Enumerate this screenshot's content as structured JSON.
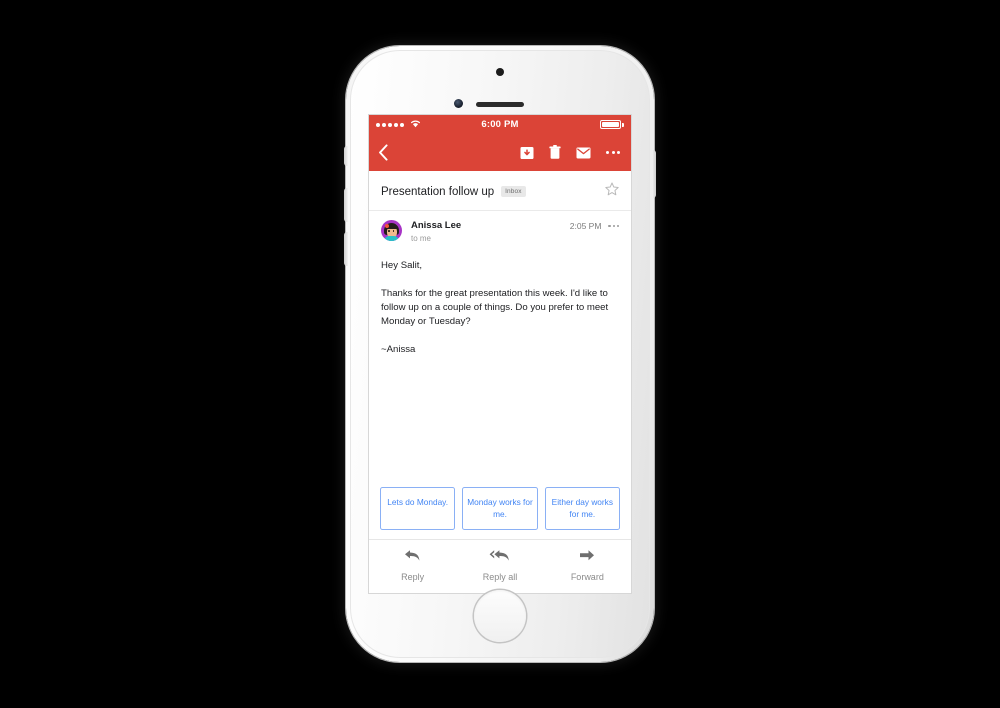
{
  "device": {
    "name": "iphone-white",
    "hardware": {
      "earpiece": "speaker-grille",
      "front_camera": "front-camera",
      "proximity_sensor": "proximity-sensor",
      "home_button": "home-button"
    }
  },
  "status_bar": {
    "signal_dots": 5,
    "wifi_icon": "wifi-icon",
    "time": "6:00 PM",
    "battery_icon": "battery-full-icon",
    "background_color": "#db4437"
  },
  "app_bar": {
    "back_icon": "back-chevron-icon",
    "actions": [
      {
        "icon": "archive-icon",
        "label": "Archive"
      },
      {
        "icon": "trash-icon",
        "label": "Delete"
      },
      {
        "icon": "mail-unread-icon",
        "label": "Mark unread"
      },
      {
        "icon": "overflow-menu-icon",
        "label": "More options"
      }
    ]
  },
  "subject": {
    "title": "Presentation follow up",
    "label": "Inbox",
    "star_icon": "star-outline-icon"
  },
  "sender": {
    "avatar_icon": "avatar",
    "name": "Anissa Lee",
    "recipient": "to me",
    "time": "2:05 PM",
    "overflow_icon": "overflow-menu-icon"
  },
  "message": {
    "greeting": "Hey Salit,",
    "paragraph": "Thanks for the great presentation this week. I'd like to follow up on a couple of things. Do you prefer to meet Monday or Tuesday?",
    "signature": "~Anissa"
  },
  "smart_replies": {
    "accent_color": "#4285f4",
    "options": [
      {
        "text": "Lets do Monday."
      },
      {
        "text": "Monday works for me."
      },
      {
        "text": "Either day works for me."
      }
    ]
  },
  "bottom_actions": [
    {
      "label": "Reply",
      "icon": "reply-arrow-icon"
    },
    {
      "label": "Reply all",
      "icon": "reply-all-arrow-icon"
    },
    {
      "label": "Forward",
      "icon": "forward-arrow-icon"
    }
  ]
}
